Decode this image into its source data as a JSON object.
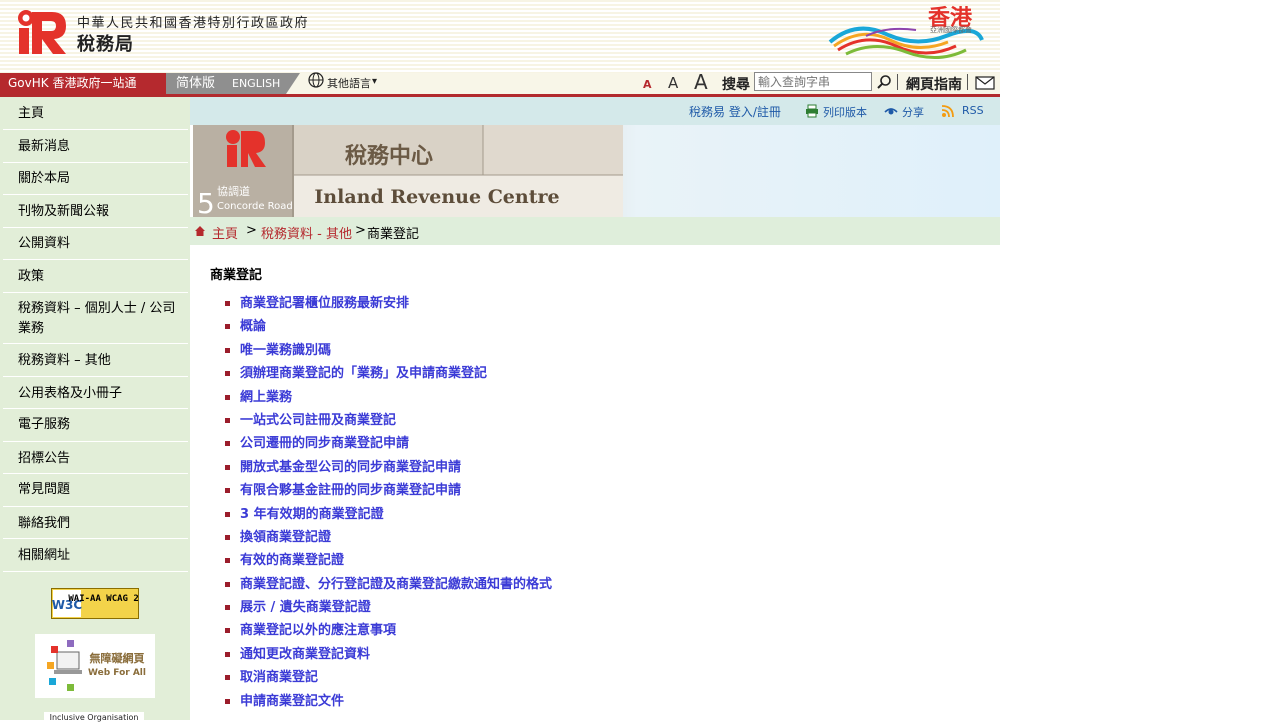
{
  "header": {
    "gov_name": "中華人民共和國香港特別行政區政府",
    "dept_name": "稅務局",
    "brand_text": "香港",
    "brand_sub": "亞洲國際都會"
  },
  "topnav": {
    "govhk": "GovHK 香港政府一站通",
    "lang_sc": "简体版",
    "lang_en": "ENGLISH",
    "other_lang": "其他語言",
    "font_small": "A",
    "font_medium": "A",
    "font_large": "A",
    "search_label": "搜尋",
    "search_placeholder": "輸入查詢字串",
    "site_guide": "網頁指南"
  },
  "util": {
    "etax": "稅務易 登入/註冊",
    "print": "列印版本",
    "share": "分享",
    "rss": "RSS"
  },
  "banner": {
    "centre_zh": "稅務中心",
    "centre_en": "Inland Revenue Centre",
    "address_no": "5",
    "address_zh": "協調道",
    "address_en": "Concorde Road"
  },
  "breadcrumb": {
    "home": "主頁",
    "sep": ">",
    "level1": "稅務資料 - 其他",
    "current": "商業登記"
  },
  "sidebar": {
    "items": [
      {
        "label": "主頁"
      },
      {
        "label": "最新消息"
      },
      {
        "label": "關於本局"
      },
      {
        "label": "刊物及新聞公報"
      },
      {
        "label": "公開資料"
      },
      {
        "label": "政策"
      },
      {
        "label": "稅務資料 – 個別人士 / 公司業務"
      },
      {
        "label": "稅務資料 – 其他"
      },
      {
        "label": "公用表格及小冊子"
      },
      {
        "label": "電子服務"
      },
      {
        "label": "招標公告"
      },
      {
        "label": "常見問題"
      },
      {
        "label": "聯絡我們"
      },
      {
        "label": "相關網址"
      }
    ],
    "badge_w3c": "WAI-AA WCAG 2.0",
    "badge_wfa_zh": "無障礙網頁",
    "badge_wfa_en": "Web For All",
    "badge_inclusive": "Inclusive Organisation"
  },
  "content": {
    "title": "商業登記",
    "links": [
      "商業登記署櫃位服務最新安排",
      "概論",
      "唯一業務識別碼",
      "須辦理商業登記的「業務」及申請商業登記",
      "網上業務",
      "一站式公司註冊及商業登記",
      "公司遷冊的同步商業登記申請",
      "開放式基金型公司的同步商業登記申請",
      "有限合夥基金註冊的同步商業登記申請",
      "3 年有效期的商業登記證",
      "換領商業登記證",
      "有效的商業登記證",
      "商業登記證、分行登記證及商業登記繳款通知書的格式",
      "展示 / 遺失商業登記證",
      "商業登記以外的應注意事項",
      "通知更改商業登記資料",
      "取消商業登記",
      "申請商業登記文件"
    ]
  }
}
